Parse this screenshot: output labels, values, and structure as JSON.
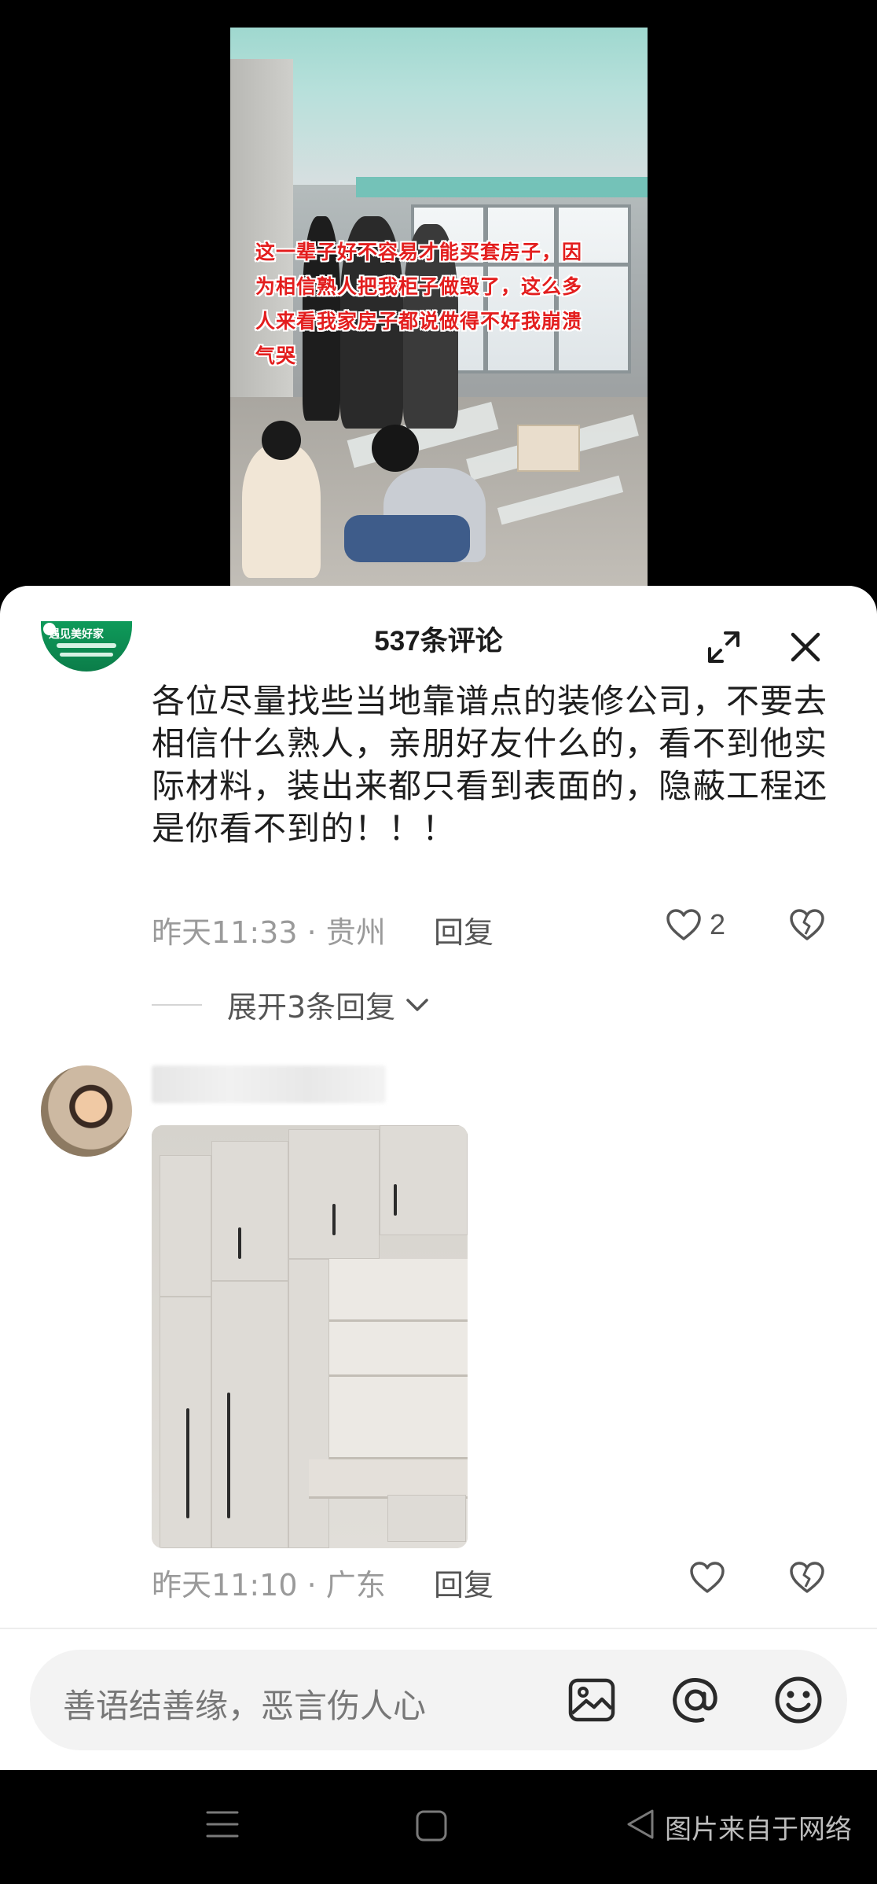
{
  "video": {
    "caption": "这一辈子好不容易才能买套房子，因为相信熟人把我柜子做毁了，这么多人来看我家房子都说做得不好我崩溃气哭"
  },
  "comments_panel": {
    "title": "537条评论",
    "expand_icon": "expand-icon",
    "close_icon": "close-icon"
  },
  "comments": [
    {
      "avatar_logo_text": "遇见美好家",
      "text": "各位尽量找些当地靠谱点的装修公司，不要去相信什么熟人，亲朋好友什么的，看不到他实际材料，装出来都只看到表面的，隐蔽工程还是你看不到的！！！",
      "meta": "昨天11:33 · 贵州",
      "reply_label": "回复",
      "like_count": "2",
      "expand_replies": "展开3条回复"
    },
    {
      "meta": "昨天11:10 · 广东",
      "reply_label": "回复",
      "image_desc": "wardrobe-photo"
    }
  ],
  "input": {
    "placeholder": "善语结善缘，恶言伤人心",
    "icons": [
      "image-icon",
      "at-icon",
      "emoji-icon"
    ]
  },
  "system_nav": {
    "watermark": "图片来自于网络"
  },
  "colors": {
    "caption_red": "#e31e1e",
    "brand_green": "#0e9a5a",
    "meta_gray": "#9a9a9a"
  }
}
